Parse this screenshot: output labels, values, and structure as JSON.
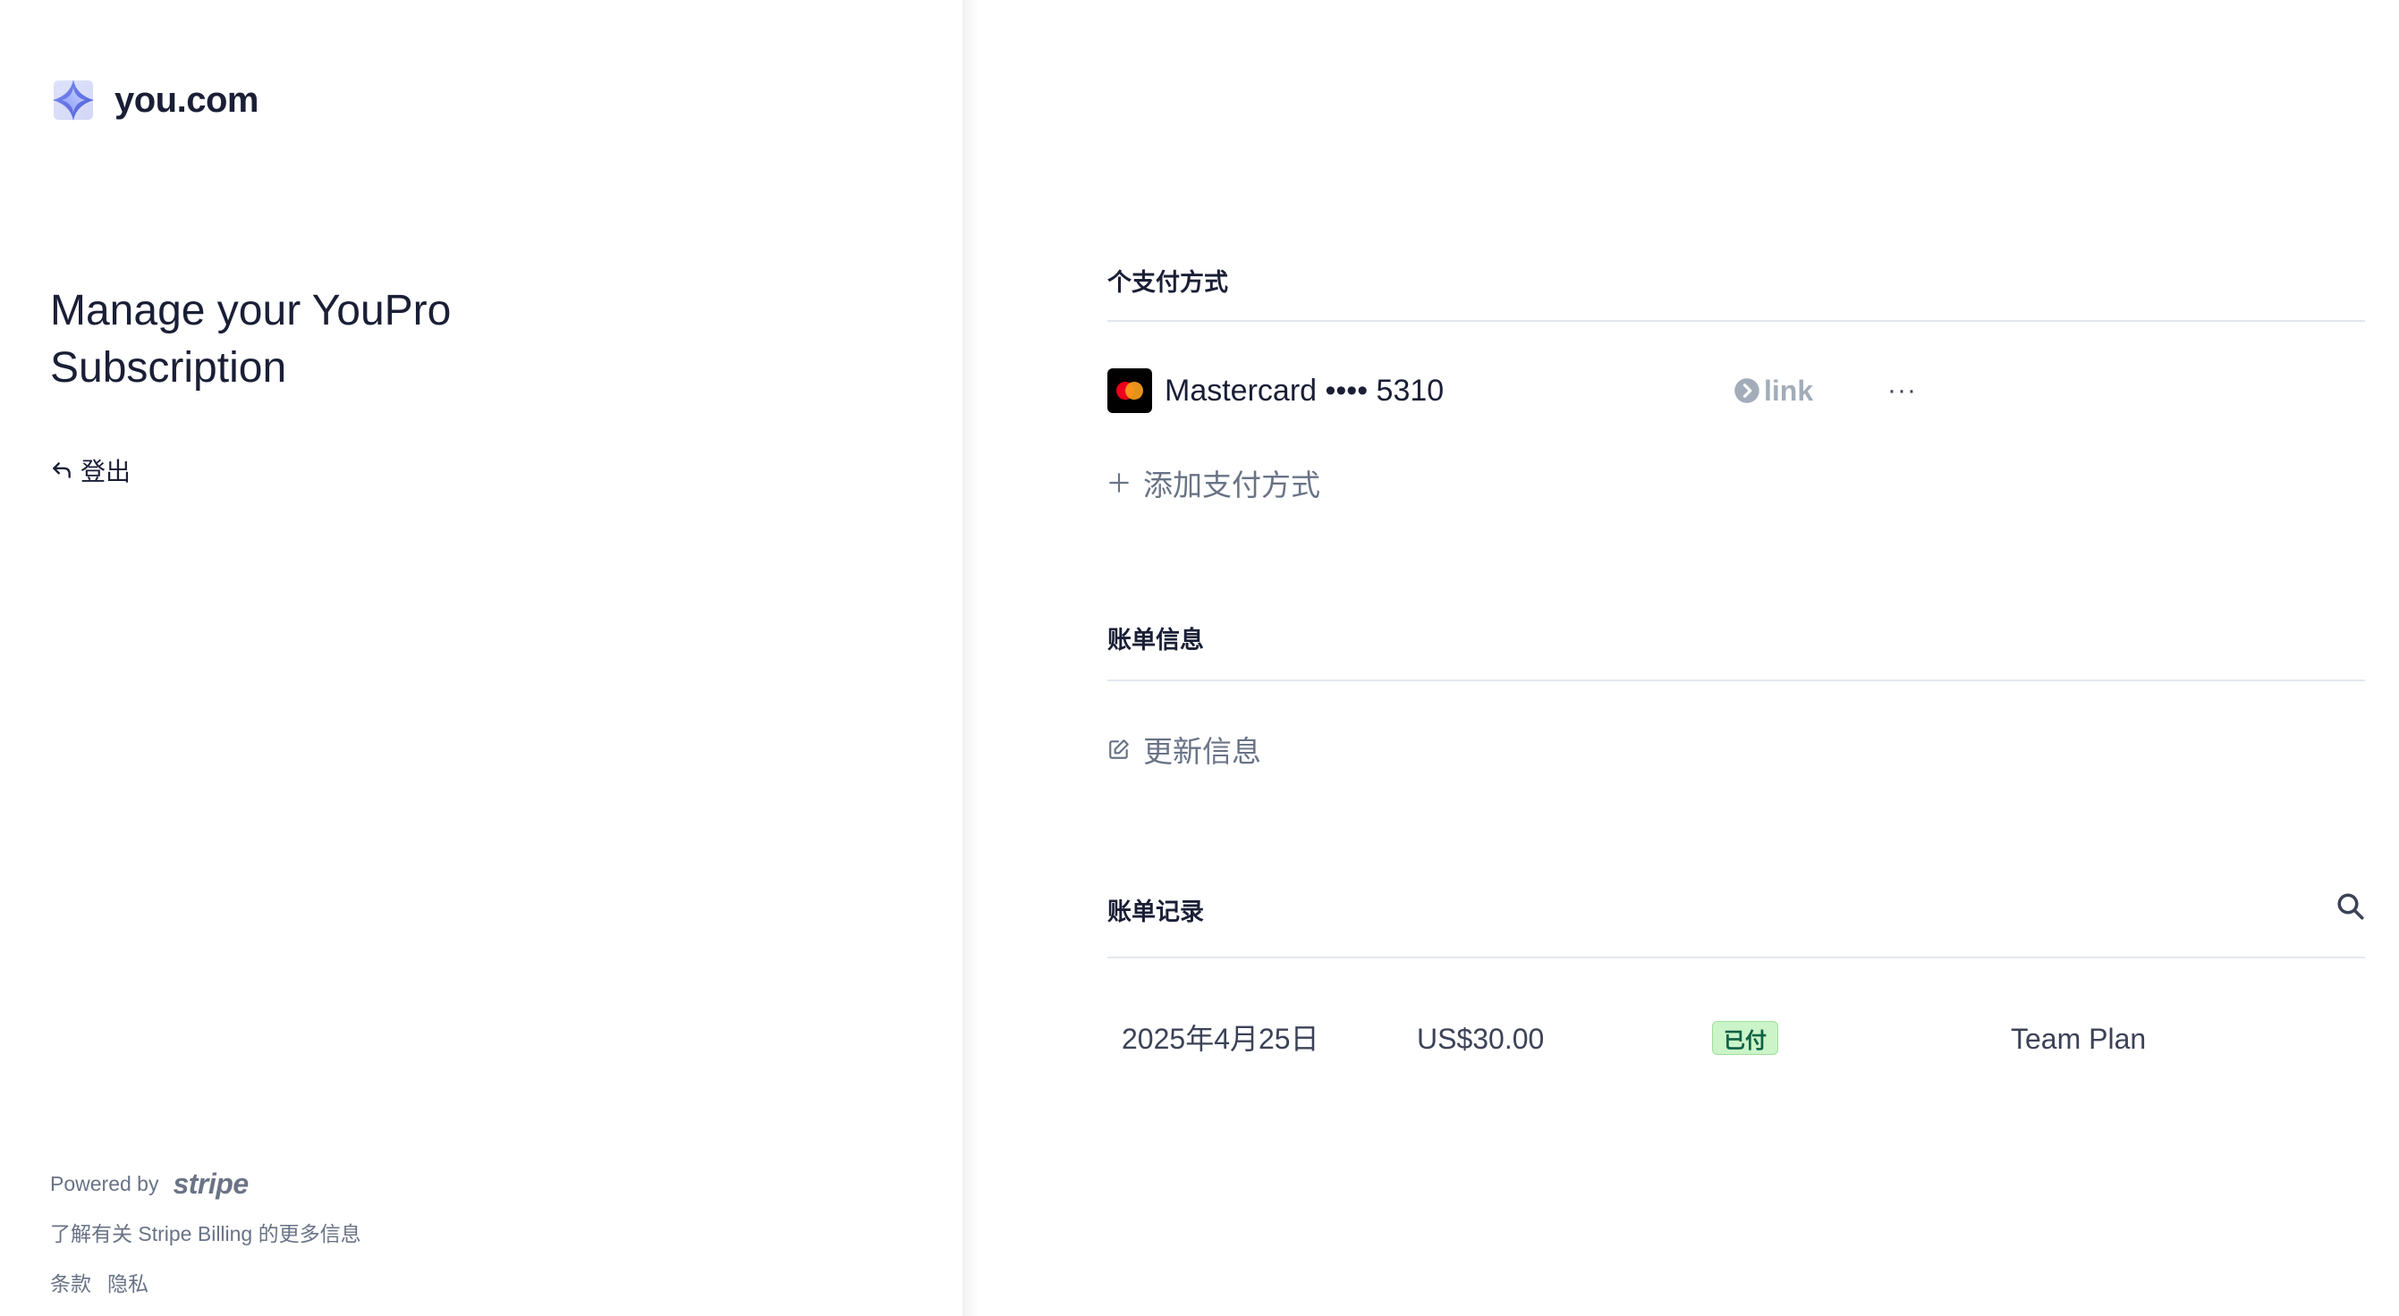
{
  "brand": {
    "name": "you.com",
    "logo_icon": "youcom-logo-icon"
  },
  "left": {
    "headline": "Manage your YouPro Subscription",
    "logout_label": "登出",
    "footer": {
      "powered_by": "Powered by",
      "stripe_word": "stripe",
      "learn_more": "了解有关 Stripe Billing 的更多信息",
      "terms": "条款",
      "privacy": "隐私"
    }
  },
  "payment": {
    "section_title": "个支付方式",
    "card": {
      "brand_icon": "mastercard-icon",
      "label": "Mastercard •••• 5310"
    },
    "link_label": "link",
    "more_label": "···",
    "add_label": "添加支付方式"
  },
  "billing_info": {
    "section_title": "账单信息",
    "update_label": "更新信息"
  },
  "history": {
    "section_title": "账单记录",
    "rows": [
      {
        "date": "2025年4月25日",
        "amount": "US$30.00",
        "status": "已付",
        "plan": "Team Plan"
      }
    ]
  },
  "colors": {
    "text_primary": "#1a1f36",
    "text_secondary": "#697386",
    "paid_bg": "#cbf4c9",
    "paid_text": "#0e6245",
    "divider": "#e3e8ee"
  }
}
